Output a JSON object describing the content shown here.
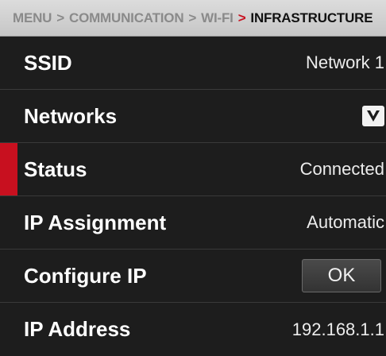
{
  "breadcrumb": {
    "items": [
      "MENU",
      "COMMUNICATION",
      "WI-FI"
    ],
    "current": "INFRASTRUCTURE",
    "separator": ">"
  },
  "rows": {
    "ssid": {
      "label": "SSID",
      "value": "Network 1"
    },
    "networks": {
      "label": "Networks",
      "icon": "chevron-down-icon"
    },
    "status": {
      "label": "Status",
      "value": "Connected",
      "selected": true
    },
    "ip_assignment": {
      "label": "IP Assignment",
      "value": "Automatic"
    },
    "configure_ip": {
      "label": "Configure IP",
      "button_label": "OK"
    },
    "ip_address": {
      "label": "IP Address",
      "value": "192.168.1.1"
    }
  },
  "colors": {
    "accent": "#c8101f",
    "background": "#1d1d1d",
    "header": "#d2d2d2"
  }
}
